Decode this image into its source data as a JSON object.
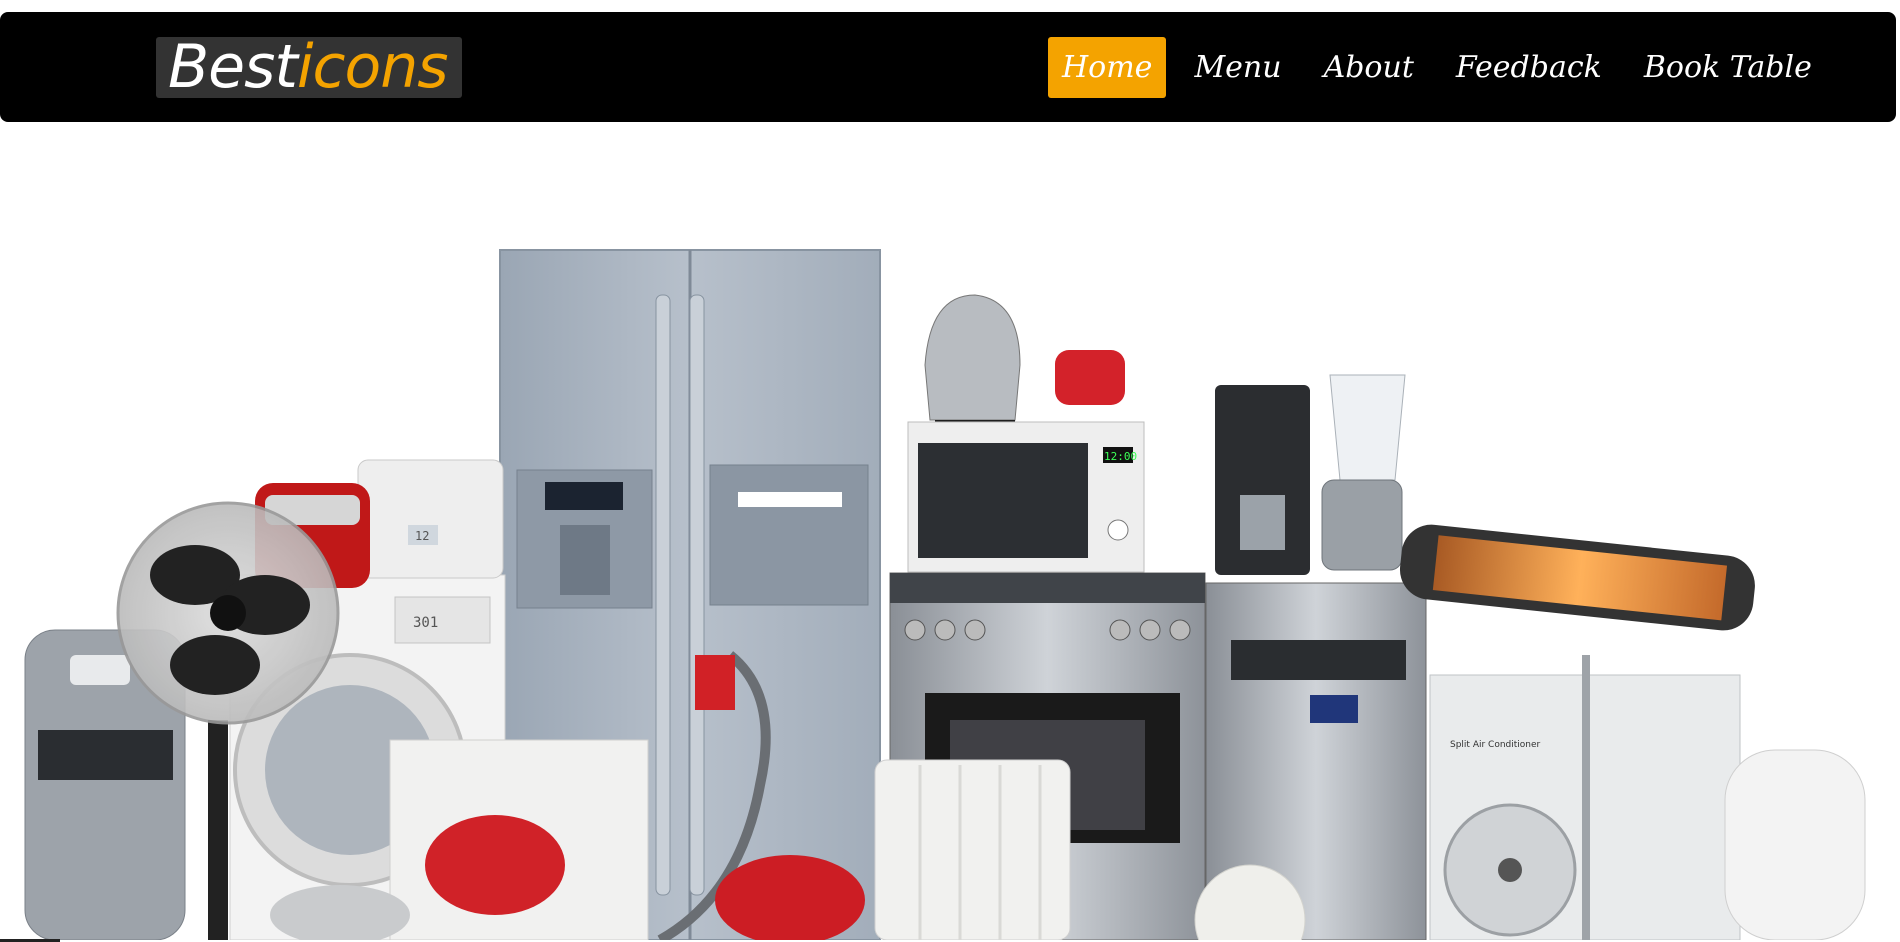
{
  "logo": {
    "part1": "Best",
    "part2": "icons"
  },
  "nav": {
    "items": [
      {
        "label": "Home",
        "active": true
      },
      {
        "label": "Menu",
        "active": false
      },
      {
        "label": "About",
        "active": false
      },
      {
        "label": "Feedback",
        "active": false
      },
      {
        "label": "Book Table",
        "active": false
      }
    ]
  },
  "hero": {
    "microwave_display": "12:00",
    "dryer_display": "12",
    "washer_display": "301",
    "ac_label": "Split Air Conditioner"
  },
  "colors": {
    "nav_bg": "#000000",
    "accent": "#f4a300",
    "logo_bg": "#333333"
  }
}
